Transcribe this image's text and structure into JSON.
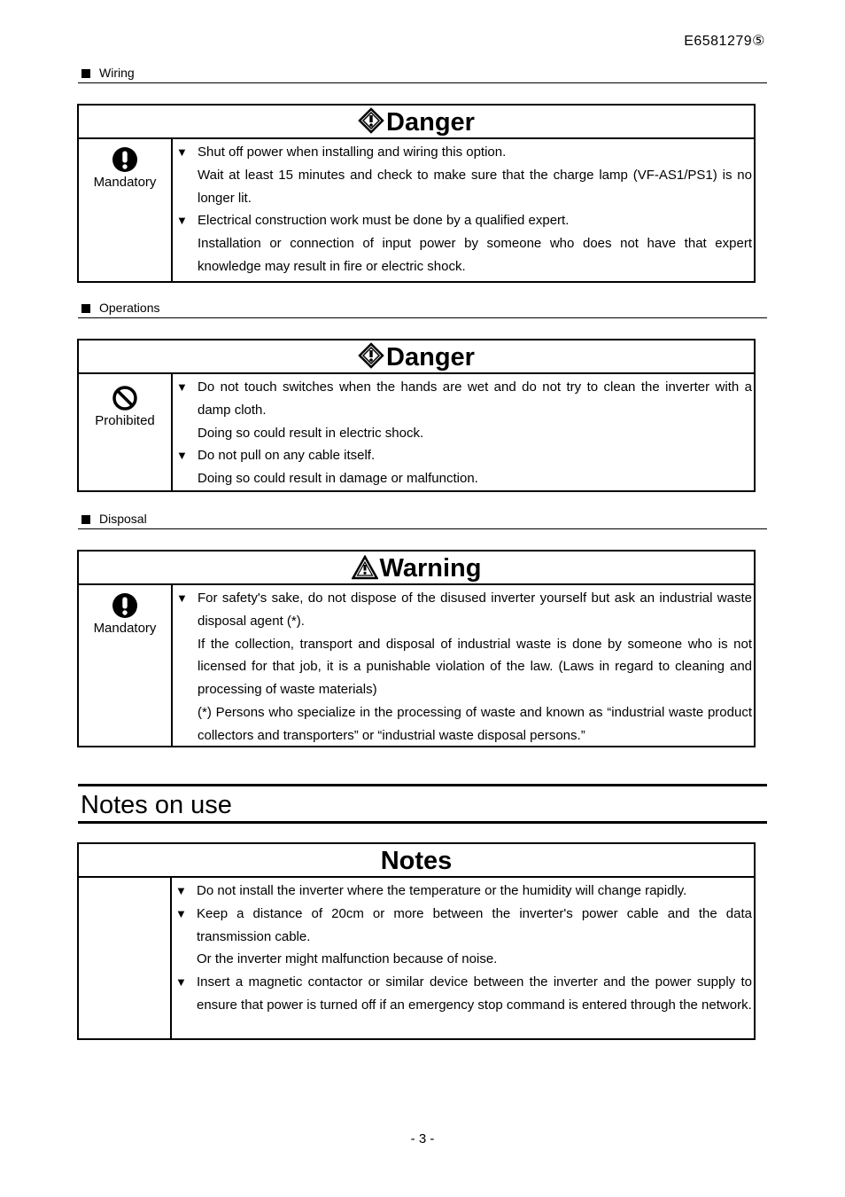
{
  "header": {
    "doc_id": "E6581279⑤"
  },
  "sections": [
    {
      "heading": "Wiring",
      "box": {
        "title": "Danger",
        "title_icon": "danger-diamond-icon",
        "left_label": "Mandatory",
        "left_icon": "mandatory-exclamation-icon",
        "items": [
          {
            "text": "Shut off power when installing and wiring this option.",
            "subs": [
              "Wait at least 15 minutes and check to make sure that the charge lamp (VF-AS1/PS1) is no longer lit."
            ]
          },
          {
            "text": "Electrical construction work must be done by a qualified expert.",
            "subs": [
              "Installation or connection of input power by someone who does not have that expert knowledge may result in fire or electric shock."
            ]
          }
        ]
      }
    },
    {
      "heading": "Operations",
      "box": {
        "title": "Danger",
        "title_icon": "danger-diamond-icon",
        "left_label": "Prohibited",
        "left_icon": "prohibited-circle-icon",
        "items": [
          {
            "text": "Do not touch switches when the hands are wet and do not try to clean the inverter with a damp cloth.",
            "subs": [
              "Doing so could result in electric shock."
            ]
          },
          {
            "text": "Do not pull on any cable itself.",
            "subs": [
              "Doing so could result in damage or malfunction."
            ]
          }
        ]
      }
    },
    {
      "heading": "Disposal",
      "box": {
        "title": "Warning",
        "title_icon": "warning-triangle-icon",
        "left_label": "Mandatory",
        "left_icon": "mandatory-exclamation-icon",
        "items": [
          {
            "text": "For safety's sake, do not dispose of the disused inverter yourself but ask an industrial waste disposal agent (*).",
            "subs": [
              "If the collection, transport and disposal of industrial waste is done by someone who is not licensed for that job, it is a punishable violation of the law. (Laws in regard to cleaning and processing of waste materials)",
              "(*) Persons who specialize in the processing of waste and known as “industrial waste product collectors and transporters” or “industrial waste disposal persons.”"
            ]
          }
        ]
      }
    }
  ],
  "notes_section": {
    "heading": "Notes on use",
    "box": {
      "title": "Notes",
      "items": [
        {
          "text": "Do not install the inverter where the temperature or the humidity will change rapidly.",
          "subs": []
        },
        {
          "text": "Keep a distance of 20cm or more between the inverter's power cable and the data transmission cable.",
          "subs": [
            "Or the inverter might malfunction because of noise."
          ]
        },
        {
          "text": "Insert a magnetic contactor or similar device between the inverter and the power supply to ensure that power is turned off if an emergency stop command is entered through the network.",
          "subs": []
        }
      ]
    }
  },
  "footer": {
    "page_number": "- 3 -"
  },
  "bullet_glyph": "▼"
}
